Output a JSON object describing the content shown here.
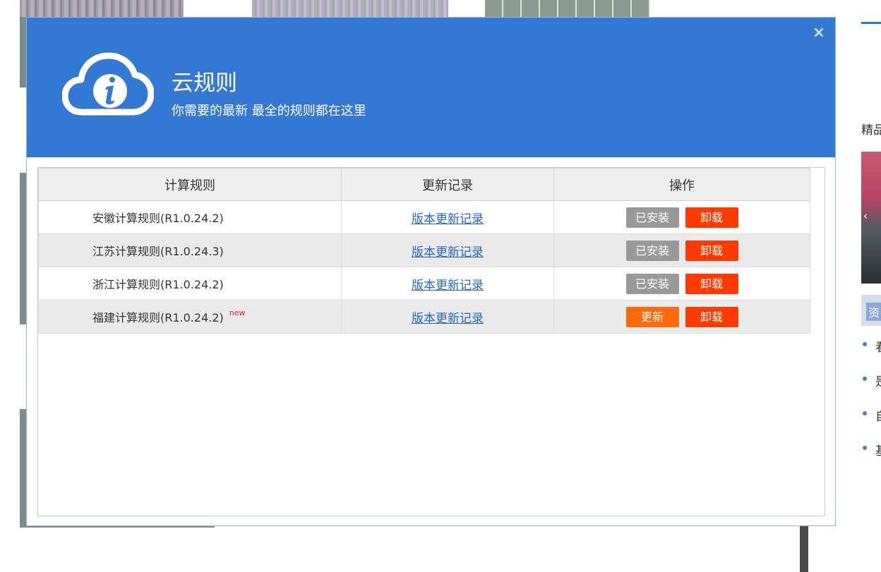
{
  "background_page": {
    "right_panel": {
      "heading": "精品",
      "tag": "资",
      "bullets": [
        "看",
        "是",
        "自",
        "基"
      ]
    }
  },
  "dialog": {
    "title": "云规则",
    "subtitle": "你需要的最新 最全的规则都在这里",
    "close_label": "×",
    "icon": "cloud-info-icon",
    "colors": {
      "header_bg": "#3378d2",
      "uninstall": "#ff3a00",
      "update": "#ff6a0a",
      "installed": "#999999",
      "new_tag": "#e02020"
    },
    "table": {
      "headers": [
        "计算规则",
        "更新记录",
        "操作"
      ],
      "rows": [
        {
          "name": "安徽计算规则(R1.0.24.2)",
          "new": "",
          "log": "版本更新记录",
          "status": "已安装",
          "uninstall": "卸载"
        },
        {
          "name": "江苏计算规则(R1.0.24.3)",
          "new": "",
          "log": "版本更新记录",
          "status": "已安装",
          "uninstall": "卸载"
        },
        {
          "name": "浙江计算规则(R1.0.24.2)",
          "new": "",
          "log": "版本更新记录",
          "status": "已安装",
          "uninstall": "卸载"
        },
        {
          "name": "福建计算规则(R1.0.24.2)",
          "new": "new",
          "log": "版本更新记录",
          "status": "更新",
          "uninstall": "卸载"
        }
      ]
    }
  }
}
